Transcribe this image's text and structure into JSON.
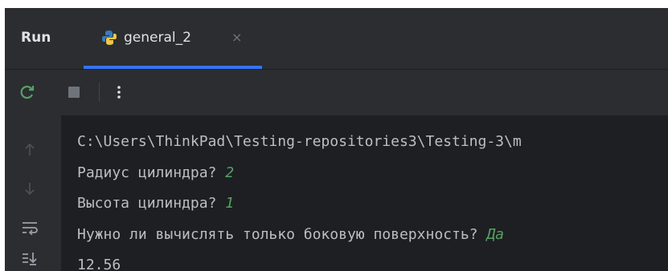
{
  "window": {
    "panel_label": "Run",
    "tabs": [
      {
        "label": "general_2",
        "icon": "python-icon",
        "active": true
      }
    ],
    "accent_color": "#3574f0"
  },
  "toolbar": {
    "buttons": [
      "rerun-icon",
      "stop-icon",
      "more-vertical-icon"
    ]
  },
  "gutter": {
    "buttons": [
      "scroll-up-icon",
      "scroll-down-icon",
      "soft-wrap-icon",
      "scroll-to-end-icon"
    ]
  },
  "console": {
    "lines": [
      {
        "text": "C:\\Users\\ThinkPad\\Testing-repositories3\\Testing-3\\m",
        "input": ""
      },
      {
        "text": "Радиус цилиндра? ",
        "input": "2"
      },
      {
        "text": "Высота цилиндра? ",
        "input": "1"
      },
      {
        "text": "Нужно ли вычислять только боковую поверхность? ",
        "input": "Да"
      },
      {
        "text": "12.56",
        "input": ""
      }
    ],
    "input_color": "#57a064"
  }
}
